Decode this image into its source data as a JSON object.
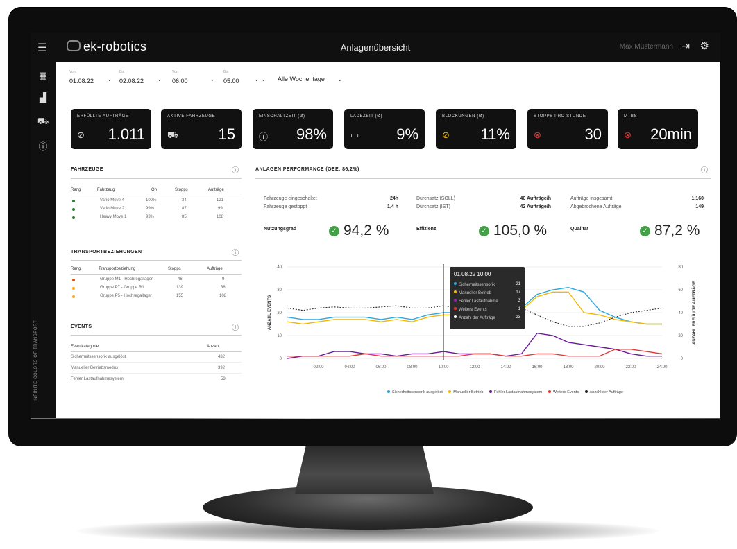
{
  "header": {
    "logo_text": "ek-robotics",
    "title": "Anlagenübersicht",
    "user": "Max Mustermann"
  },
  "sidebar": {
    "tagline": "INFINITE COLORS OF TRANSPORT",
    "icons": [
      "dashboard-icon",
      "chart-icon",
      "vehicle-icon",
      "info-icon"
    ]
  },
  "filters": [
    {
      "small": "Von",
      "value": "01.08.22"
    },
    {
      "small": "Bis",
      "value": "02.08.22"
    },
    {
      "small": "Von",
      "value": "06:00"
    },
    {
      "small": "Bis",
      "value": "05:00"
    },
    {
      "small": "",
      "value": "Alle Wochentage"
    }
  ],
  "kpis": [
    {
      "title": "ERFÜLLTE AUFTRÄGE",
      "value": "1.011",
      "icon": "check-circle-icon"
    },
    {
      "title": "AKTIVE FAHRZEUGE",
      "value": "15",
      "icon": "vehicle-icon"
    },
    {
      "title": "EINSCHALTZEIT (Ø)",
      "value": "98%",
      "icon": "power-icon"
    },
    {
      "title": "LADEZEIT (Ø)",
      "value": "9%",
      "icon": "battery-icon"
    },
    {
      "title": "BLOCKUNGEN (Ø)",
      "value": "11%",
      "icon": "blocked-icon"
    },
    {
      "title": "STOPPS PRO STUNDE",
      "value": "30",
      "icon": "stop-icon"
    },
    {
      "title": "MTBS",
      "value": "20min",
      "icon": "stop-icon"
    }
  ],
  "vehicles": {
    "title": "FAHRZEUGE",
    "headers": [
      "Rang",
      "Fahrzeug",
      "On",
      "Stopps",
      "Aufträge"
    ],
    "rows": [
      {
        "name": "Vario Move 4",
        "on": "100%",
        "stopps": "34",
        "auftraege": "121",
        "color": "#2e7d32"
      },
      {
        "name": "Vario Move 2",
        "on": "99%",
        "stopps": "87",
        "auftraege": "99",
        "color": "#2e7d32"
      },
      {
        "name": "Heavy Move 1",
        "on": "93%",
        "stopps": "85",
        "auftraege": "108",
        "color": "#2e7d32"
      }
    ]
  },
  "transport": {
    "title": "TRANSPORTBEZIEHUNGEN",
    "headers": [
      "Rang",
      "Transportbeziehung",
      "Stopps",
      "Aufträge"
    ],
    "rows": [
      {
        "name": "Gruppe M1 - Hochregallager",
        "stopps": "46",
        "auftraege": "9",
        "color": "#e65100"
      },
      {
        "name": "Gruppe P7 - Gruppe R1",
        "stopps": "139",
        "auftraege": "38",
        "color": "#f9a825"
      },
      {
        "name": "Gruppe P5 - Hochregallager",
        "stopps": "155",
        "auftraege": "108",
        "color": "#f9a825"
      }
    ]
  },
  "events": {
    "title": "EVENTS",
    "headers": [
      "Eventkategorie",
      "Anzahl"
    ],
    "rows": [
      {
        "name": "Sicherheitssensorik ausgelöst",
        "count": "432"
      },
      {
        "name": "Manueller Betriebsmodus",
        "count": "392"
      },
      {
        "name": "Fehler Lastaufnahmesystem",
        "count": "58"
      }
    ]
  },
  "performance": {
    "title": "ANLAGEN PERFORMANCE (OEE: 86,2%)",
    "metrics": [
      {
        "label": "Fahrzeuge eingeschaltet",
        "value": "24h"
      },
      {
        "label": "Fahrzeuge gestoppt",
        "value": "1,4 h"
      },
      {
        "label": "Durchsatz (SOLL)",
        "value": "40 Aufträge/h"
      },
      {
        "label": "Durchsatz (IST)",
        "value": "42 Aufträge/h"
      },
      {
        "label": "Aufträge insgesamt",
        "value": "1.160"
      },
      {
        "label": "Abgebrochene Aufträge",
        "value": "149"
      }
    ],
    "big": [
      {
        "label": "Nutzungsgrad",
        "value": "94,2 %"
      },
      {
        "label": "Effizienz",
        "value": "105,0 %"
      },
      {
        "label": "Qualität",
        "value": "87,2 %"
      }
    ]
  },
  "chart_data": {
    "type": "line",
    "x": [
      "00:00",
      "01:00",
      "02:00",
      "03:00",
      "04:00",
      "05:00",
      "06:00",
      "07:00",
      "08:00",
      "09:00",
      "10:00",
      "11:00",
      "12:00",
      "13:00",
      "14:00",
      "15:00",
      "16:00",
      "17:00",
      "18:00",
      "19:00",
      "20:00",
      "21:00",
      "22:00",
      "23:00",
      "24:00"
    ],
    "x_ticks": [
      "02:00",
      "04:00",
      "06:00",
      "08:00",
      "10:00",
      "12:00",
      "14:00",
      "16:00",
      "18:00",
      "20:00",
      "22:00",
      "24:00"
    ],
    "ylabel": "ANZAHL EVENTS",
    "y2label": "ANZAHL ERFÜLLTE AUFTRÄGE",
    "ylim": [
      0,
      40
    ],
    "y_ticks": [
      0,
      10,
      20,
      30,
      40
    ],
    "y2lim": [
      0,
      80
    ],
    "y2_ticks": [
      0,
      20,
      40,
      60,
      80
    ],
    "series": [
      {
        "name": "Sicherheitssensorik ausgelöst",
        "color": "#29a9e0",
        "axis": "left",
        "values": [
          18,
          17,
          17,
          18,
          18,
          18,
          17,
          18,
          17,
          19,
          20,
          20,
          20,
          20,
          19,
          22,
          28,
          30,
          31,
          29,
          21,
          18,
          16,
          15,
          15
        ]
      },
      {
        "name": "Manueller Betrieb",
        "color": "#f5b700",
        "axis": "left",
        "values": [
          16,
          15,
          16,
          17,
          17,
          17,
          16,
          17,
          16,
          18,
          19,
          19,
          19,
          19,
          18,
          21,
          27,
          29,
          29,
          20,
          19,
          17,
          16,
          15,
          15
        ]
      },
      {
        "name": "Fehler Lastaufnahmesystem",
        "color": "#6a1b9a",
        "axis": "left",
        "values": [
          0,
          1,
          1,
          3,
          3,
          2,
          2,
          1,
          2,
          2,
          3,
          2,
          2,
          2,
          1,
          2,
          11,
          10,
          7,
          6,
          5,
          4,
          2,
          1,
          1
        ]
      },
      {
        "name": "Weitere Events",
        "color": "#e53935",
        "axis": "left",
        "values": [
          1,
          1,
          1,
          1,
          1,
          2,
          1,
          1,
          1,
          1,
          1,
          1,
          2,
          2,
          1,
          1,
          2,
          2,
          1,
          1,
          1,
          4,
          4,
          3,
          2
        ]
      },
      {
        "name": "Anzahl der Aufträge",
        "color": "#222222",
        "axis": "right",
        "dashed": true,
        "values": [
          44,
          42,
          44,
          45,
          44,
          44,
          45,
          46,
          44,
          44,
          46,
          44,
          44,
          46,
          46,
          44,
          38,
          32,
          28,
          28,
          31,
          36,
          40,
          42,
          44
        ]
      }
    ],
    "cursor_index": 10,
    "tooltip": {
      "title": "01.08.22 10:00",
      "rows": [
        {
          "name": "Sicherheitssensorik",
          "value": "21",
          "color": "#29a9e0"
        },
        {
          "name": "Manueller Betrieb",
          "value": "17",
          "color": "#f5b700"
        },
        {
          "name": "Fehler Lastaufnahme",
          "value": "3",
          "color": "#6a1b9a"
        },
        {
          "name": "Weitere Events",
          "value": "1",
          "color": "#e53935"
        },
        {
          "name": "Anzahl der Aufträge",
          "value": "23",
          "color": "#222222"
        }
      ]
    },
    "legend": [
      {
        "name": "Sicherheitssensorik ausgelöst",
        "color": "#29a9e0"
      },
      {
        "name": "Manueller Betrieb",
        "color": "#f5b700"
      },
      {
        "name": "Fehler Lastaufnahmesystem",
        "color": "#6a1b9a"
      },
      {
        "name": "Weitere Events",
        "color": "#e53935"
      },
      {
        "name": "Anzahl der Aufträge",
        "color": "#222222"
      }
    ]
  }
}
